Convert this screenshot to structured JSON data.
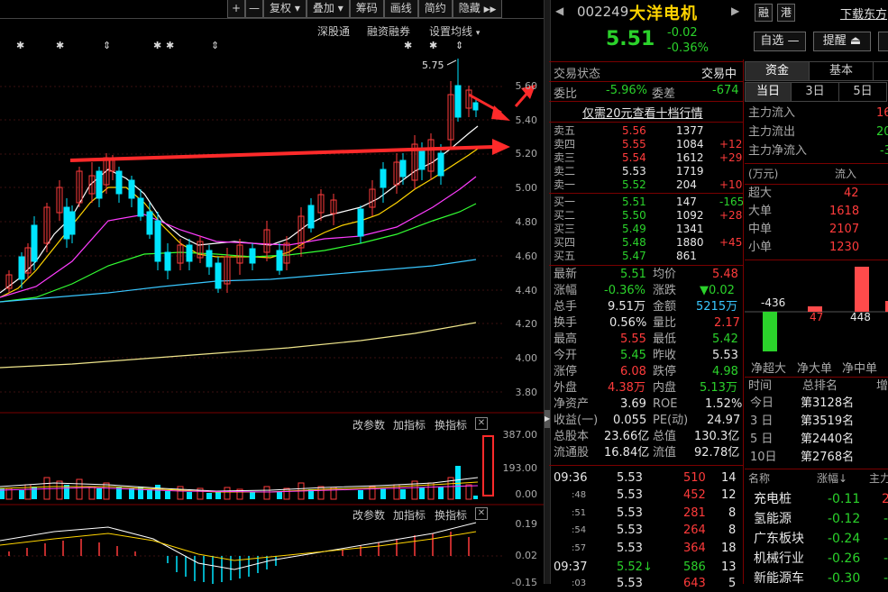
{
  "toolbar": {
    "buttons": [
      "+",
      "—",
      "复权",
      "叠加",
      "筹码",
      "画线",
      "简约",
      "隐藏"
    ],
    "hide_arrow": "▶▶"
  },
  "chart_header": {
    "links": [
      "深股通",
      "融资融券",
      "设置均线"
    ],
    "peak_label": "5.75"
  },
  "price_axis": [
    "5.60",
    "5.40",
    "5.20",
    "5.00",
    "4.80",
    "4.60",
    "4.40",
    "4.20",
    "4.00",
    "3.80"
  ],
  "volume_panel": {
    "links": [
      "改参数",
      "加指标",
      "换指标"
    ],
    "axis": [
      "387.00",
      "193.00",
      "0.00"
    ]
  },
  "macd_panel": {
    "links": [
      "改参数",
      "加指标",
      "换指标"
    ],
    "axis": [
      "0.19",
      "0.02",
      "-0.15"
    ]
  },
  "quote": {
    "code": "002249",
    "name": "大洋电机",
    "tags": [
      "融",
      "港"
    ],
    "download_link": "下载东方",
    "price": "5.51",
    "change": "-0.02",
    "change_pct": "-0.36%",
    "btn_watch": "自选 —",
    "btn_alert": "提醒 ⏏",
    "trade_status_label": "交易状态",
    "trade_status_value": "交易中",
    "weibi_label": "委比",
    "weibi_value": "-5.96%",
    "weicha_label": "委差",
    "weicha_value": "-674",
    "l2_link": "仅需20元查看十档行情"
  },
  "orderbook": {
    "asks": [
      {
        "label": "卖五",
        "price": "5.56",
        "vol": "1377",
        "chg": ""
      },
      {
        "label": "卖四",
        "price": "5.55",
        "vol": "1084",
        "chg": "+12"
      },
      {
        "label": "卖三",
        "price": "5.54",
        "vol": "1612",
        "chg": "+29"
      },
      {
        "label": "卖二",
        "price": "5.53",
        "vol": "1719",
        "chg": ""
      },
      {
        "label": "卖一",
        "price": "5.52",
        "vol": "204",
        "chg": "+10"
      }
    ],
    "bids": [
      {
        "label": "买一",
        "price": "5.51",
        "vol": "147",
        "chg": "-165"
      },
      {
        "label": "买二",
        "price": "5.50",
        "vol": "1092",
        "chg": "+28"
      },
      {
        "label": "买三",
        "price": "5.49",
        "vol": "1341",
        "chg": ""
      },
      {
        "label": "买四",
        "price": "5.48",
        "vol": "1880",
        "chg": "+45"
      },
      {
        "label": "买五",
        "price": "5.47",
        "vol": "861",
        "chg": ""
      }
    ]
  },
  "stats": [
    {
      "l1": "最新",
      "v1": "5.51",
      "l2": "均价",
      "v2": "5.48"
    },
    {
      "l1": "涨幅",
      "v1": "-0.36%",
      "l2": "涨跌",
      "v2": "▼0.02"
    },
    {
      "l1": "总手",
      "v1": "9.51万",
      "l2": "金额",
      "v2": "5215万"
    },
    {
      "l1": "换手",
      "v1": "0.56%",
      "l2": "量比",
      "v2": "2.17"
    },
    {
      "l1": "最高",
      "v1": "5.55",
      "l2": "最低",
      "v2": "5.42"
    },
    {
      "l1": "今开",
      "v1": "5.45",
      "l2": "昨收",
      "v2": "5.53"
    },
    {
      "l1": "涨停",
      "v1": "6.08",
      "l2": "跌停",
      "v2": "4.98"
    },
    {
      "l1": "外盘",
      "v1": "4.38万",
      "l2": "内盘",
      "v2": "5.13万"
    },
    {
      "l1": "净资产",
      "v1": "3.69",
      "l2": "ROE",
      "v2": "1.52%"
    },
    {
      "l1": "收益(一)",
      "v1": "0.055",
      "l2": "PE(动)",
      "v2": "24.97"
    },
    {
      "l1": "总股本",
      "v1": "23.66亿",
      "l2": "总值",
      "v2": "130.3亿"
    },
    {
      "l1": "流通股",
      "v1": "16.84亿",
      "l2": "流值",
      "v2": "92.78亿"
    }
  ],
  "ticks": [
    {
      "time": "09:36",
      "price": "5.53",
      "vol": "510",
      "n": "14"
    },
    {
      "time": ":48",
      "price": "5.53",
      "vol": "452",
      "n": "12"
    },
    {
      "time": ":51",
      "price": "5.53",
      "vol": "281",
      "n": "8"
    },
    {
      "time": ":54",
      "price": "5.53",
      "vol": "264",
      "n": "8"
    },
    {
      "time": ":57",
      "price": "5.53",
      "vol": "364",
      "n": "18"
    },
    {
      "time": "09:37",
      "price": "5.52↓",
      "vol": "586",
      "n": "13"
    },
    {
      "time": ":03",
      "price": "5.53",
      "vol": "643",
      "n": "5"
    }
  ],
  "fund": {
    "tabs": [
      "资金",
      "基本"
    ],
    "periods": [
      "当日",
      "3日",
      "5日"
    ],
    "rows": [
      {
        "label": "主力流入",
        "value": "16"
      },
      {
        "label": "主力流出",
        "value": "20"
      },
      {
        "label": "主力净流入",
        "value": "-3"
      }
    ],
    "unit": "(万元)",
    "flow_label": "流入",
    "table": [
      {
        "label": "超大",
        "value": "42"
      },
      {
        "label": "大单",
        "value": "1618"
      },
      {
        "label": "中单",
        "value": "2107"
      },
      {
        "label": "小单",
        "value": "1230"
      }
    ],
    "bars": [
      {
        "label": "净超大",
        "value": "-436",
        "num": -436
      },
      {
        "label": "净大单",
        "value": "47",
        "num": 47
      },
      {
        "label": "净中单",
        "value": "448",
        "num": 448
      }
    ]
  },
  "rank": {
    "h1": "时间",
    "h2": "总排名",
    "h3": "增",
    "rows": [
      {
        "t": "今日",
        "r": "第3128名"
      },
      {
        "t": "3 日",
        "r": "第3519名"
      },
      {
        "t": "5 日",
        "r": "第2440名"
      },
      {
        "t": "10日",
        "r": "第2768名"
      }
    ]
  },
  "sectors": {
    "h1": "名称",
    "h2": "涨幅↓",
    "h3": "主力",
    "rows": [
      {
        "name": "充电桩",
        "chg": "-0.11"
      },
      {
        "name": "氢能源",
        "chg": "-0.12"
      },
      {
        "name": "广东板块",
        "chg": "-0.24"
      },
      {
        "name": "机械行业",
        "chg": "-0.26"
      },
      {
        "name": "新能源车",
        "chg": "-0.30"
      }
    ]
  },
  "colors": {
    "up": "#ff3b3b",
    "down": "#2bd22b",
    "candle_down": "#00e5ff",
    "border": "#7a0000",
    "annotation": "#ff2a2a"
  }
}
